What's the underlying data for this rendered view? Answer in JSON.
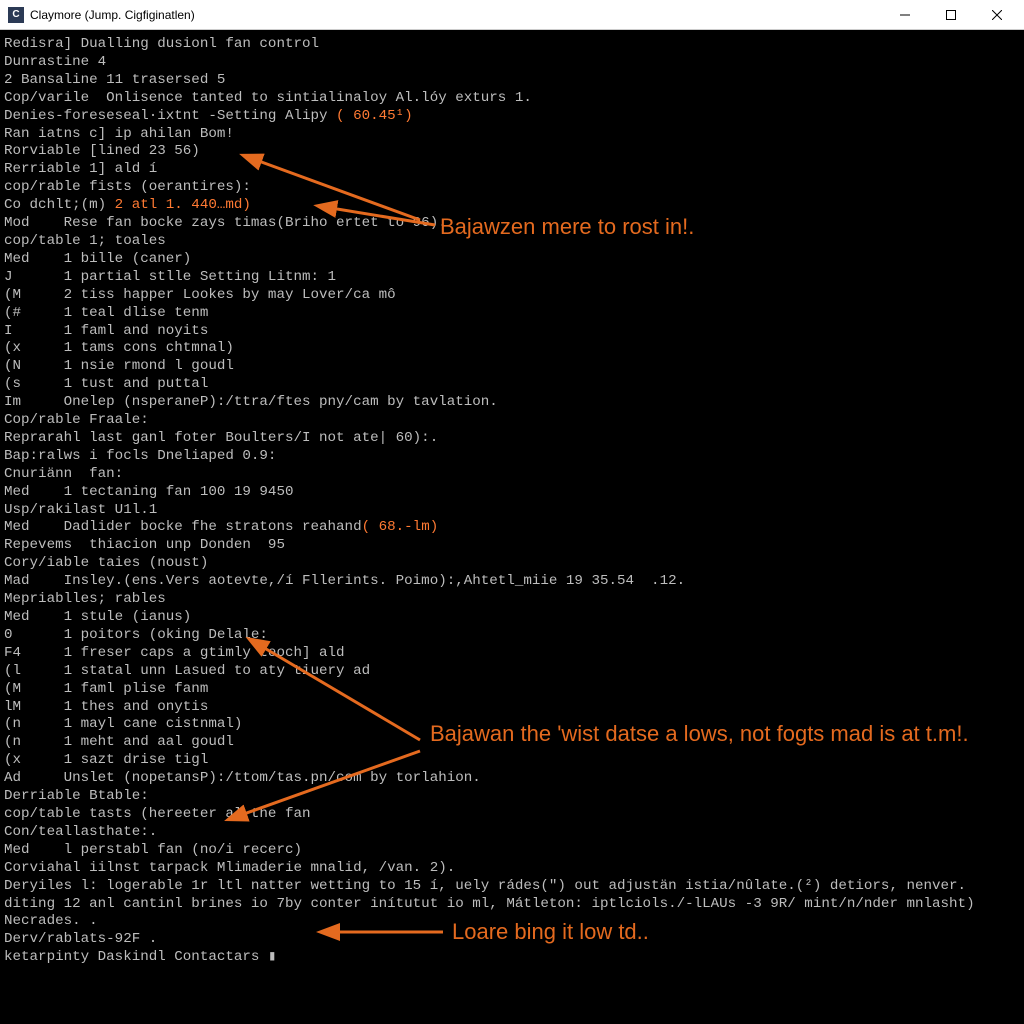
{
  "title": "Claymore (Jump. Cigfiginatlen)",
  "titlebar_icon_glyph": "C",
  "lines": [
    {
      "pre": "Redisra] Dualling dusionl fan control"
    },
    {
      "pre": "Dunrastine 4"
    },
    {
      "pre": "2 Bansaline 11 trasersed 5"
    },
    {
      "pre": "Cop/varile  Onlisence tanted to sintialinaloy Al.lóy exturs 1."
    },
    {
      "pre": ""
    },
    {
      "pre": "Denies-foreseseal·ixtnt -Setting Alipy",
      "hl": " ( 60.45¹)"
    },
    {
      "pre": "Ran iatns c] ip ahilan Bom!"
    },
    {
      "pre": "Rorviable [lined 23 56)"
    },
    {
      "pre": "Rerriable 1] ald í"
    },
    {
      "pre": "cop/rable fists (oerantires):"
    },
    {
      "pre": "Co",
      "pre2": " dchlt;(m)",
      "hl": " 2 atl 1. 440…md)"
    },
    {
      "pre": "Mod    Rese fan bocke zays timas(Briho ertet to 96)."
    },
    {
      "pre": "cop/table 1; toales"
    },
    {
      "pre": "Med    1 bille (caner)"
    },
    {
      "pre": ""
    },
    {
      "pre": "J      1 partial stlle Setting Litnm: 1"
    },
    {
      "pre": "(M     2 tiss happer Lookes by may Lover/ca mô"
    },
    {
      "pre": "(#     1 teal dlise tenm"
    },
    {
      "pre": "I      1 faml and noyits"
    },
    {
      "pre": "(x     1 tams cons chtmnal)"
    },
    {
      "pre": "(N     1 nsie rmond l goudl"
    },
    {
      "pre": "(s     1 tust and puttal"
    },
    {
      "pre": "Im     Onelep (nsperaneP):/ttra/ftes pny/cam by tavlation."
    },
    {
      "pre": ""
    },
    {
      "pre": "Cop/rable Fraale:"
    },
    {
      "pre": "Reprarahl last ganl foter Boulters/I not ate| 60):."
    },
    {
      "pre": ""
    },
    {
      "pre": "Bap:ralws i focls Dneliaped 0.9:"
    },
    {
      "pre": "Cnuriänn  fan:"
    },
    {
      "pre": "Med    1 tectaning fan 100 19 9450"
    },
    {
      "pre": "Usp/rakilast U1l.1"
    },
    {
      "pre": "Med    Dadlider bocke fhe stratons reahand",
      "hl": "( 68.-lm)"
    },
    {
      "pre": "Repevems  thiacion unp Donden  95"
    },
    {
      "pre": "Cory/iable taies (noust)"
    },
    {
      "pre": "Mad    Insley.(ens.Vers aotevte,/í Fllerints. Poimo):,Ahtetl_miie 19 35.54  .12."
    },
    {
      "pre": "Mepriablles; rables"
    },
    {
      "pre": "Med    1 stule (ianus)"
    },
    {
      "pre": ""
    },
    {
      "pre": "0      1 poitors (oking Delale:"
    },
    {
      "pre": "F4     1 freser caps a gtimly teoch] ald"
    },
    {
      "pre": "(l     1 statal unn Lasued to aty tiuery ad"
    },
    {
      "pre": "(M     1 faml plise fanm"
    },
    {
      "pre": "lM     1 thes and onytis"
    },
    {
      "pre": "(n     1 mayl cane cistnmal)"
    },
    {
      "pre": "(n     1 meht and aal goudl"
    },
    {
      "pre": "(x     1 sazt drise tigl"
    },
    {
      "pre": "Ad     Unslet (nopetansP):/ttom/tas.pn/com by torlahion."
    },
    {
      "pre": ""
    },
    {
      "pre": "Derriable Btable:"
    },
    {
      "pre": "cop/table tasts (hereeter al the fan"
    },
    {
      "pre": "Con/teallasthate:."
    },
    {
      "pre": "Med    l perstabl fan (no/i recerc)"
    },
    {
      "pre": "Corviahal iilnst tarpack Mlimaderie mnalid, /van. 2)."
    },
    {
      "pre": "Deryiles l: logerable 1r ltl natter wetting to 15 í, uely rádes(\") out adjustän istia/nûlate.(²) detiors, nenver."
    },
    {
      "pre": "diting 12 anl cantinl brines io 7by conter inítutut io ml, Mátleton: iptlciols./-lLAUs -3 9R/ mint/n/nder mnlasht)"
    },
    {
      "pre": "Necrades. ."
    },
    {
      "pre": "Derv/rablats-92F ."
    },
    {
      "pre": "ketarpinty Daskindl Contactars ▮"
    }
  ],
  "annotations": {
    "a1": "Bajawzen mere to rost in!.",
    "a2": "Bajawan the 'wist datse a lows, not fogts mad is at t.m!.",
    "a3": "Loare bing it low td.."
  }
}
